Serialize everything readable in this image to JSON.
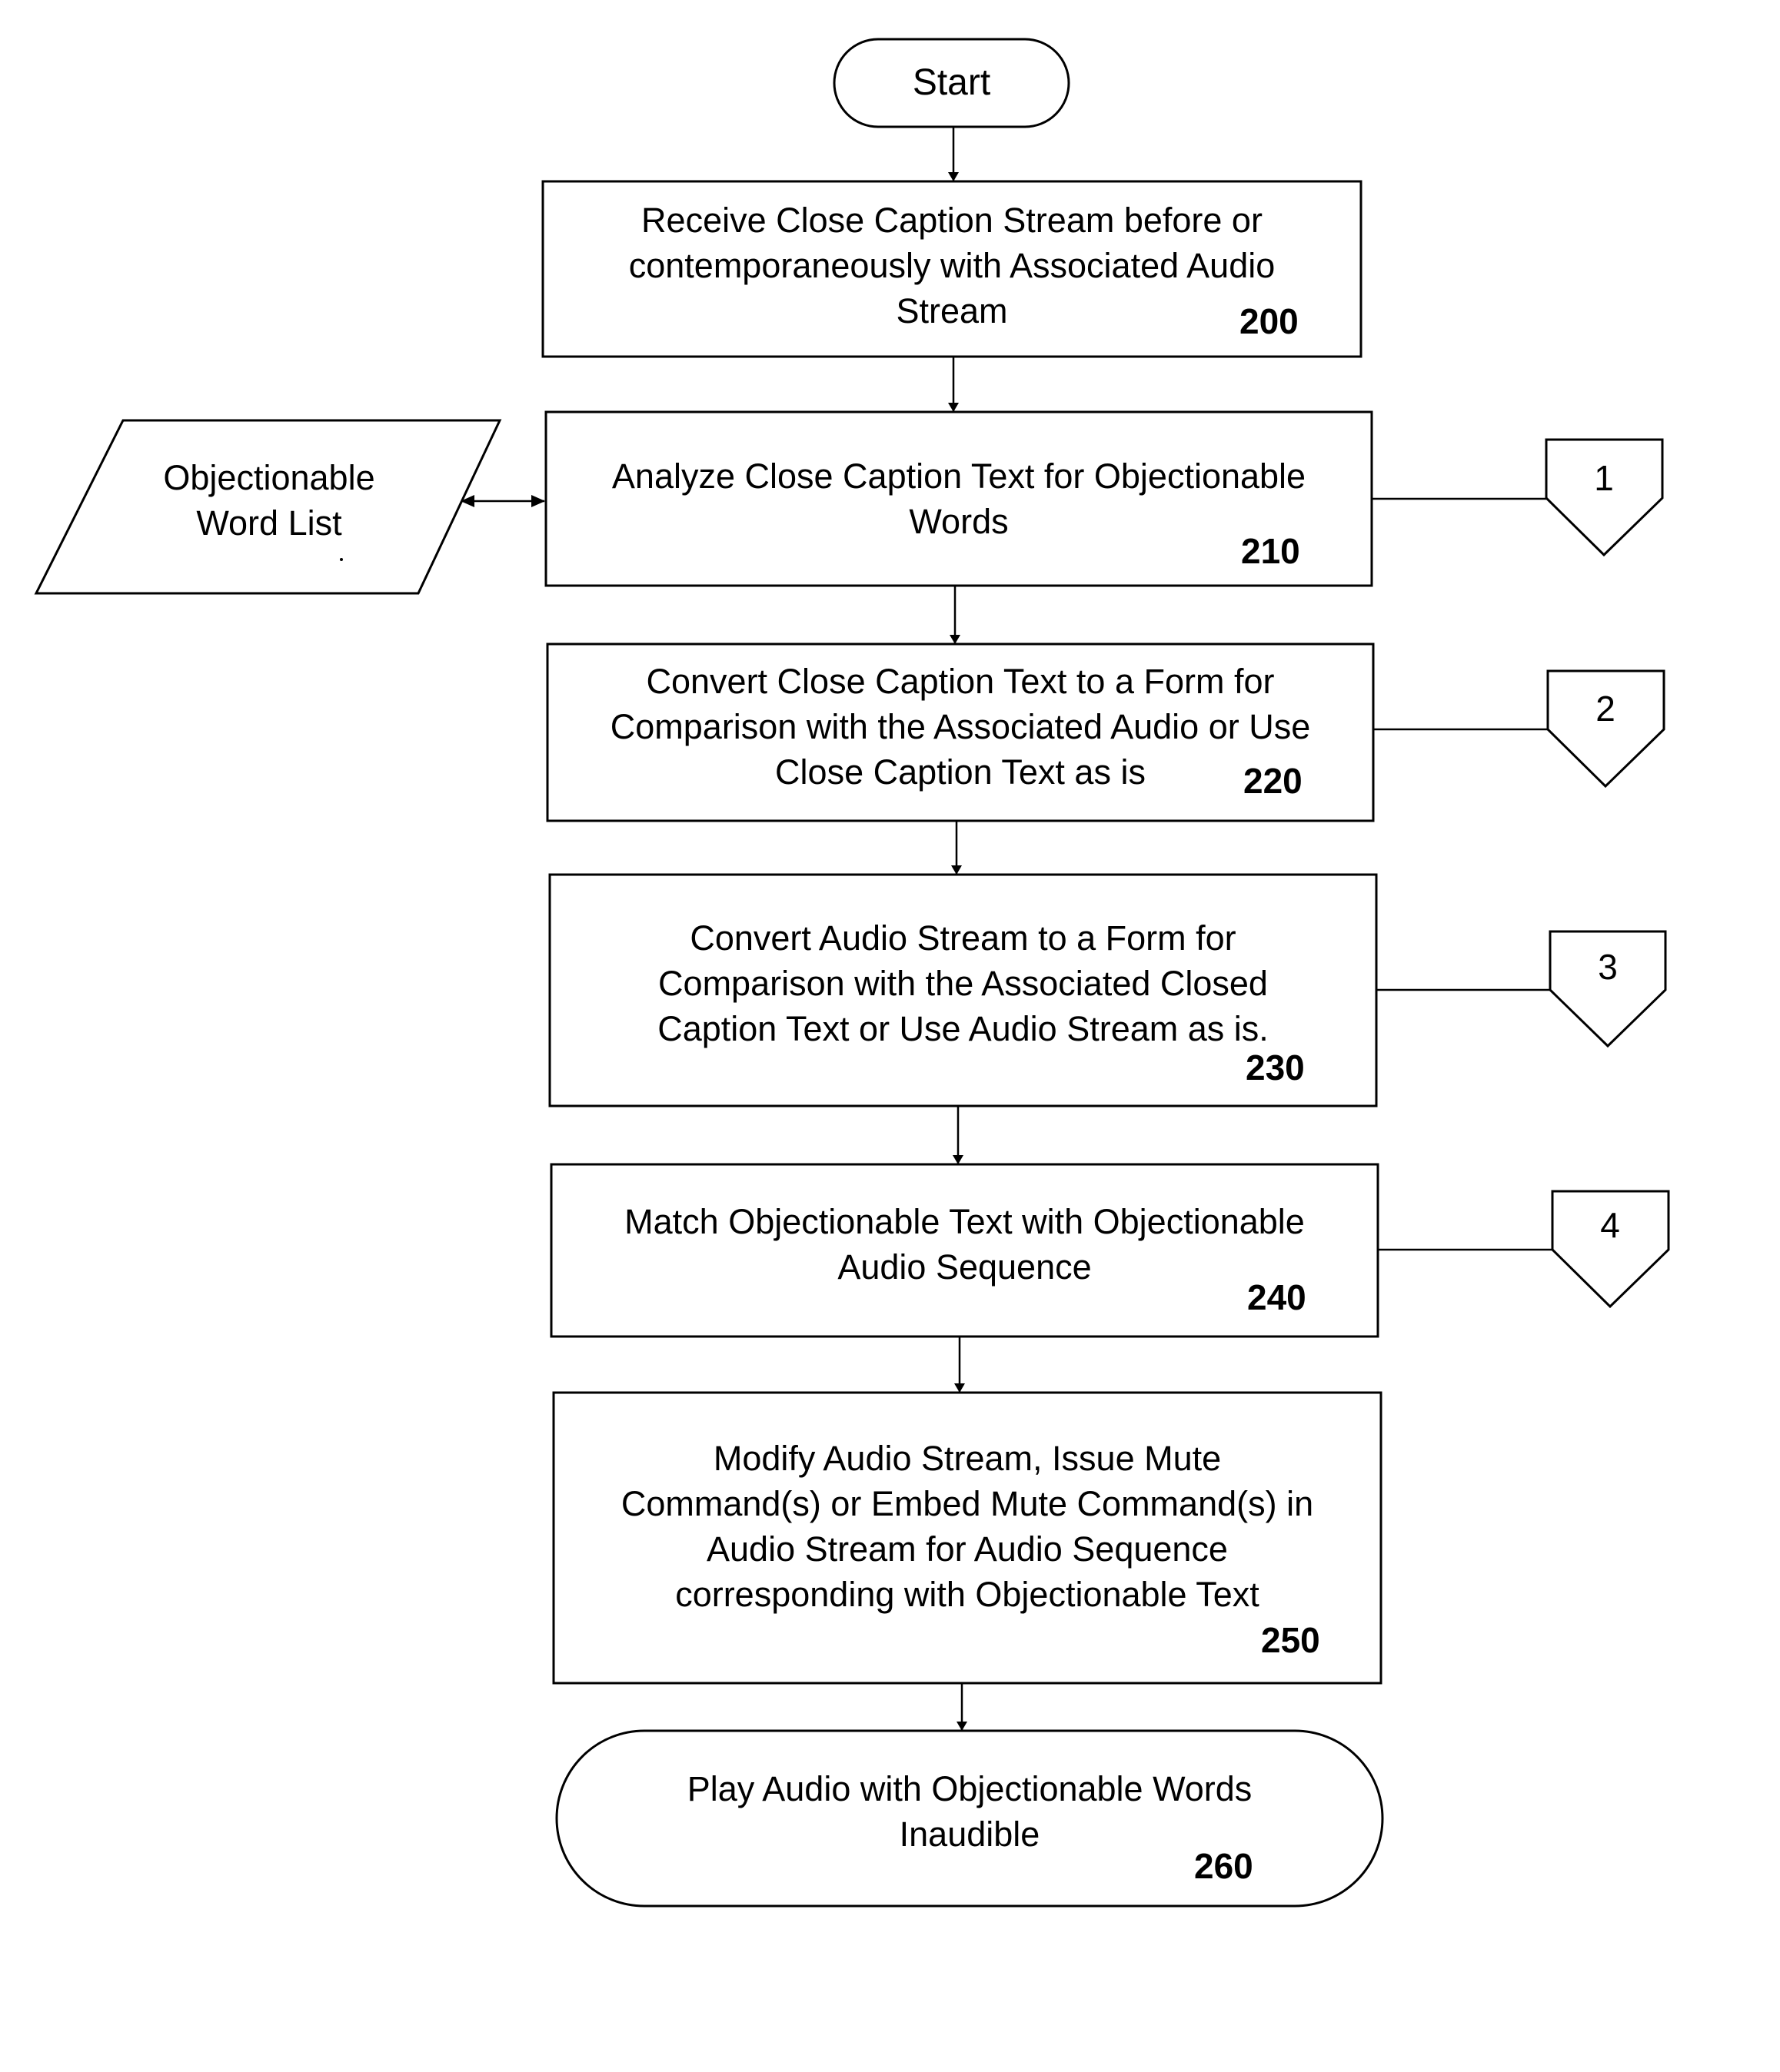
{
  "diagram": {
    "type": "flowchart",
    "start": {
      "label": "Start"
    },
    "data_store": {
      "label_lines": [
        "Objectionable",
        "Word List"
      ]
    },
    "steps": [
      {
        "id": "200",
        "lines": [
          "Receive Close Caption Stream before or",
          "contemporaneously with Associated Audio",
          "Stream"
        ],
        "ref": "200"
      },
      {
        "id": "210",
        "lines": [
          "Analyze Close Caption Text for Objectionable",
          "Words"
        ],
        "ref": "210",
        "connector": "1"
      },
      {
        "id": "220",
        "lines": [
          "Convert Close Caption Text to a Form for",
          "Comparison with the Associated Audio or Use",
          "Close Caption Text as is"
        ],
        "ref": "220",
        "connector": "2"
      },
      {
        "id": "230",
        "lines": [
          "Convert Audio Stream to a Form for",
          "Comparison with the Associated Closed",
          "Caption Text or Use Audio Stream as is."
        ],
        "ref": "230",
        "connector": "3"
      },
      {
        "id": "240",
        "lines": [
          "Match Objectionable Text with Objectionable",
          "Audio Sequence"
        ],
        "ref": "240",
        "connector": "4"
      },
      {
        "id": "250",
        "lines": [
          "Modify Audio Stream, Issue Mute",
          "Command(s) or Embed Mute Command(s) in",
          "Audio Stream for Audio Sequence",
          "corresponding with Objectionable Text"
        ],
        "ref": "250"
      }
    ],
    "end": {
      "lines": [
        "Play Audio with Objectionable Words",
        "Inaudible"
      ],
      "ref": "260"
    },
    "connectors": [
      "1",
      "2",
      "3",
      "4"
    ],
    "edges": [
      {
        "from": "start",
        "to": "200"
      },
      {
        "from": "200",
        "to": "210"
      },
      {
        "from": "word-list",
        "to": "210",
        "bidirectional": true
      },
      {
        "from": "210",
        "to": "220"
      },
      {
        "from": "220",
        "to": "230"
      },
      {
        "from": "230",
        "to": "240"
      },
      {
        "from": "240",
        "to": "250"
      },
      {
        "from": "250",
        "to": "260"
      },
      {
        "from": "210",
        "to": "connector-1"
      },
      {
        "from": "220",
        "to": "connector-2"
      },
      {
        "from": "230",
        "to": "connector-3"
      },
      {
        "from": "240",
        "to": "connector-4"
      }
    ]
  }
}
